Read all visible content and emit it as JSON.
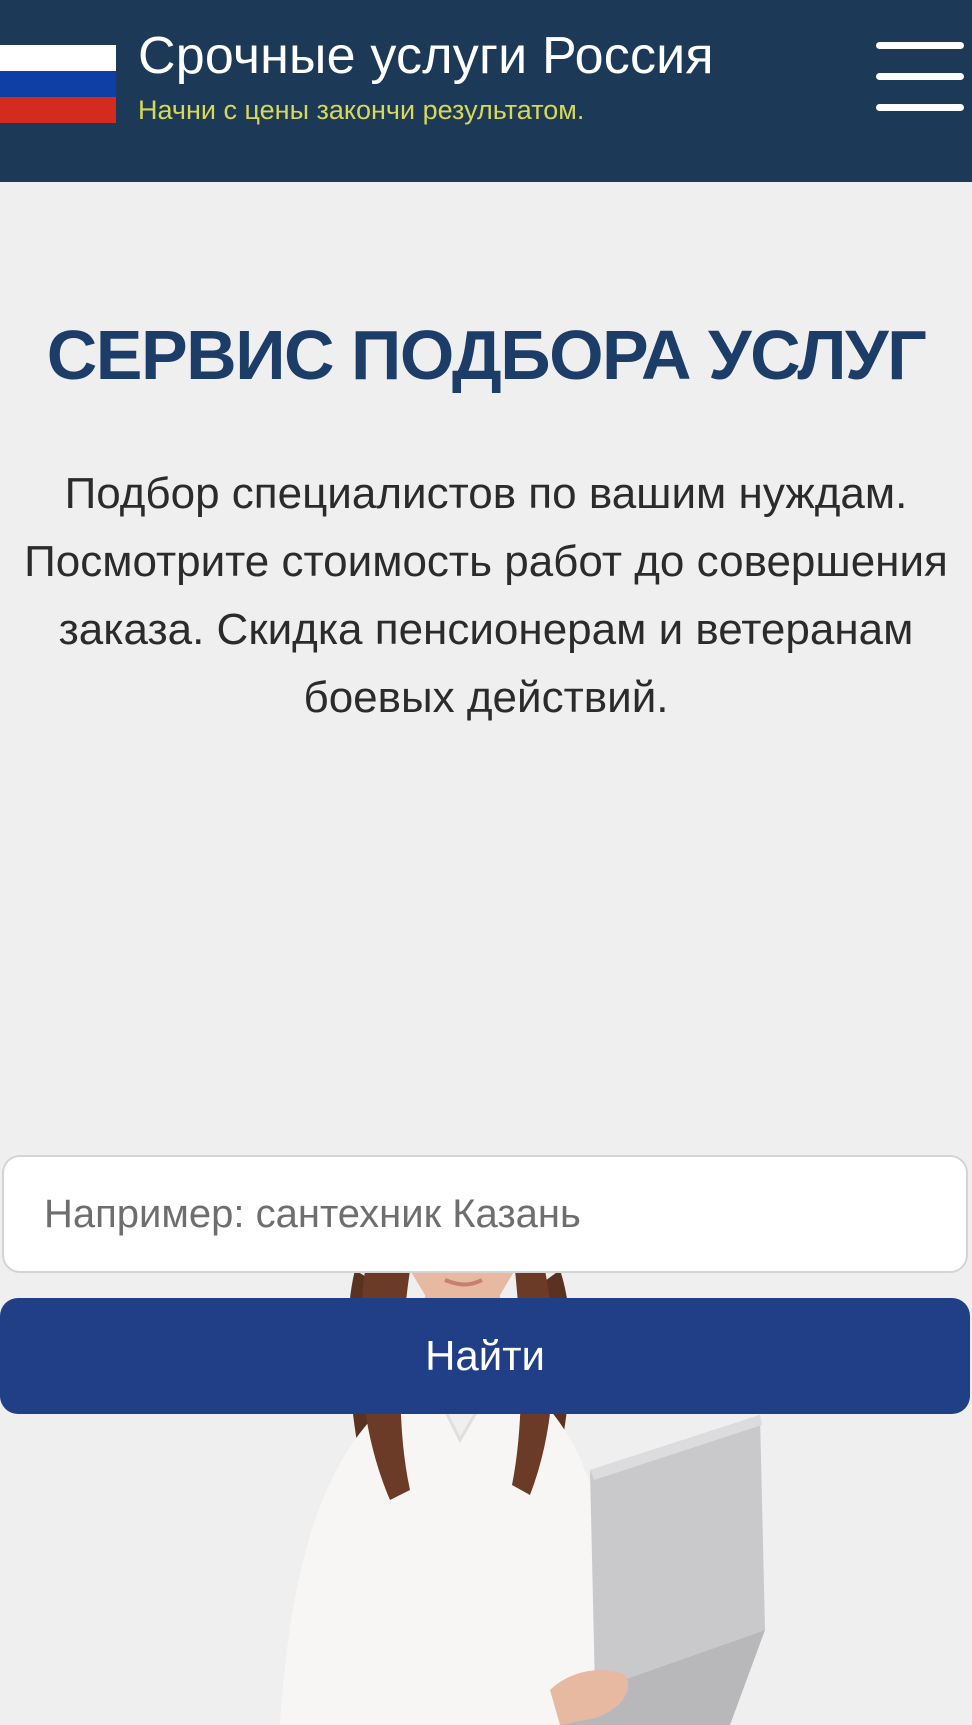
{
  "header": {
    "title": "Срочные услуги Россия",
    "tagline": "Начни с цены закончи результатом.",
    "icons": {
      "logo": "russian-flag-icon",
      "menu": "hamburger-menu-icon"
    }
  },
  "hero": {
    "heading": "СЕРВИС ПОДБОРА УСЛУГ",
    "description": "Подбор специалистов по вашим нуждам. Посмотрите стоимость работ до совершения заказа. Скидка пенсионерам и ветеранам боевых действий."
  },
  "search": {
    "value": "",
    "placeholder": "Например: сантехник Казань",
    "button_label": "Найти"
  },
  "colors": {
    "header_bg": "#1c3a57",
    "page_bg": "#efeff0",
    "heading": "#1c3d68",
    "tagline": "#d8d857",
    "button_bg": "#213f86"
  }
}
